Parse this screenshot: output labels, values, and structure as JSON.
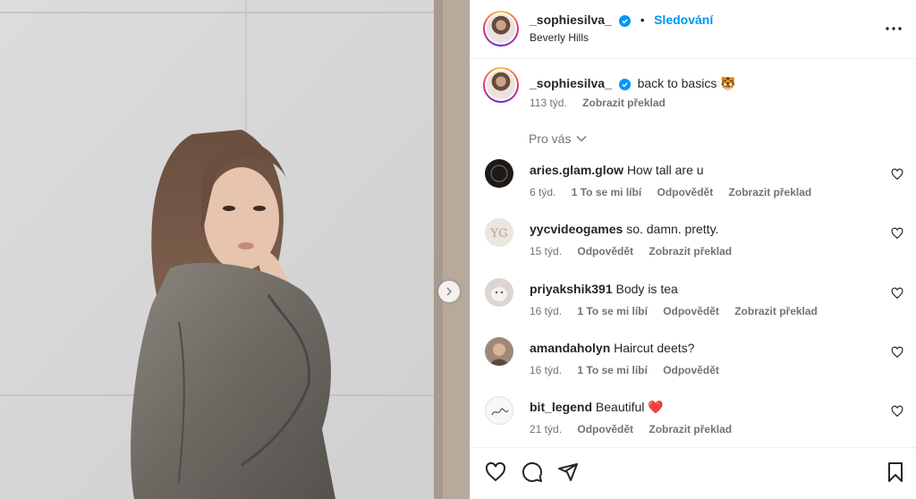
{
  "post": {
    "author": "_sophiesilva_",
    "follow_label": "Sledování",
    "separator": "•",
    "location": "Beverly Hills",
    "caption_text": "back to basics 🐯",
    "caption_time": "113 týd.",
    "translate_label": "Zobrazit překlad"
  },
  "comments_sort": {
    "label": "Pro vás"
  },
  "comments": [
    {
      "user": "aries.glam.glow",
      "text": "How tall are u",
      "time": "6 týd.",
      "likes": "1 To se mi líbí",
      "reply": "Odpovědět",
      "translate": "Zobrazit překlad"
    },
    {
      "user": "yycvideogames",
      "text": "so. damn. pretty.",
      "time": "15 týd.",
      "likes": "",
      "reply": "Odpovědět",
      "translate": "Zobrazit překlad"
    },
    {
      "user": "priyakshik391",
      "text": "Body is tea",
      "time": "16 týd.",
      "likes": "1 To se mi líbí",
      "reply": "Odpovědět",
      "translate": "Zobrazit překlad"
    },
    {
      "user": "amandaholyn",
      "text": "Haircut deets?",
      "time": "16 týd.",
      "likes": "1 To se mi líbí",
      "reply": "Odpovědět",
      "translate": ""
    },
    {
      "user": "bit_legend",
      "text": "Beautiful ❤️",
      "time": "21 týd.",
      "likes": "",
      "reply": "Odpovědět",
      "translate": "Zobrazit překlad"
    }
  ],
  "icons": {
    "verified": "verified-badge-icon",
    "more": "more-options-icon",
    "next": "chevron-right-icon",
    "like": "heart-icon",
    "comment": "comment-icon",
    "share": "share-icon",
    "save": "bookmark-icon"
  },
  "colors": {
    "accent": "#0095f6",
    "muted": "#737373",
    "text": "#262626"
  }
}
